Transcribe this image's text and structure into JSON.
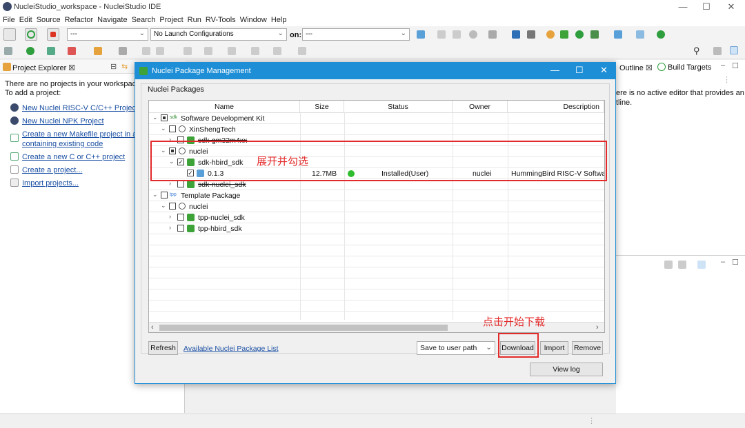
{
  "window": {
    "title": "NucleiStudio_workspace - NucleiStudio IDE",
    "minimize": "—",
    "maximize": "☐",
    "close": "✕"
  },
  "menu": [
    "File",
    "Edit",
    "Source",
    "Refactor",
    "Navigate",
    "Search",
    "Project",
    "Run",
    "RV-Tools",
    "Window",
    "Help"
  ],
  "toolbar": {
    "mode_value": "---",
    "launch_config": "No Launch Configurations",
    "on_label": "on:",
    "target_value": "---"
  },
  "project_explorer": {
    "tab": "Project Explorer ☒",
    "message_line1": "There are no projects in your workspace.",
    "message_line2": "To add a project:",
    "links": [
      "New Nuclei RISC-V C/C++ Project",
      "New Nuclei NPK Project",
      "Create a new Makefile project in a d",
      "containing existing code",
      "Create a new C or C++ project",
      "Create a project...",
      "Import projects..."
    ]
  },
  "right_panel": {
    "outline_tab": "Outline ☒",
    "build_tab": "Build Targets",
    "msg1": "ere is no active editor that provides an",
    "msg2": "tline."
  },
  "dialog": {
    "title": "Nuclei Package Management",
    "group": "Nuclei Packages",
    "columns": [
      "Name",
      "Size",
      "Status",
      "Owner",
      "Description"
    ],
    "rows": [
      {
        "name": "Software Development Kit",
        "badge": "sdk"
      },
      {
        "name": "XinShengTech"
      },
      {
        "name": "sdk-gm32m4xx"
      },
      {
        "name": "nuclei"
      },
      {
        "name": "sdk-hbird_sdk"
      },
      {
        "name": "0.1.3",
        "size": "12.7MB",
        "status": "Installed(User)",
        "owner": "nuclei",
        "description": "HummingBird RISC-V Softwar"
      },
      {
        "name": "sdk-nuclei_sdk"
      },
      {
        "name": "Template Package",
        "badge": "tpp"
      },
      {
        "name": "nuclei"
      },
      {
        "name": "tpp-nuclei_sdk"
      },
      {
        "name": "tpp-hbird_sdk"
      }
    ],
    "buttons": {
      "refresh": "Refresh",
      "list_link": "Available Nuclei Package List",
      "save_path": "Save to user path",
      "download": "Download",
      "import": "Import",
      "remove": "Remove",
      "view_log": "View log"
    },
    "annotations": {
      "expand_check": "展开并勾选",
      "click_download": "点击开始下载"
    }
  }
}
